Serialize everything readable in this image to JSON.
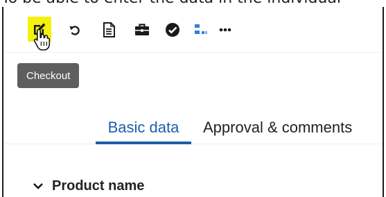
{
  "caption": "To be able to enter the data in the individual",
  "toolbar": {
    "buttons": [
      {
        "name": "checkout",
        "icon": "edit-square-icon",
        "highlighted": true,
        "highlight_color": "#f4f10c"
      },
      {
        "name": "undo",
        "icon": "undo-icon"
      },
      {
        "name": "document",
        "icon": "document-icon"
      },
      {
        "name": "briefcase",
        "icon": "briefcase-icon"
      },
      {
        "name": "approve",
        "icon": "check-circle-icon"
      },
      {
        "name": "structure",
        "icon": "structure-icon",
        "color": "#2f7fd8"
      },
      {
        "name": "more",
        "icon": "more-icon"
      }
    ]
  },
  "tooltip": {
    "text": "Checkout",
    "background": "#5e5e5e"
  },
  "tabs": [
    {
      "label": "Basic data",
      "active": true
    },
    {
      "label": "Approval & comments",
      "active": false
    }
  ],
  "colors": {
    "accent": "#1c5fa8"
  },
  "section": {
    "title": "Product name",
    "icon": "chevron-down-icon",
    "expanded": true
  }
}
